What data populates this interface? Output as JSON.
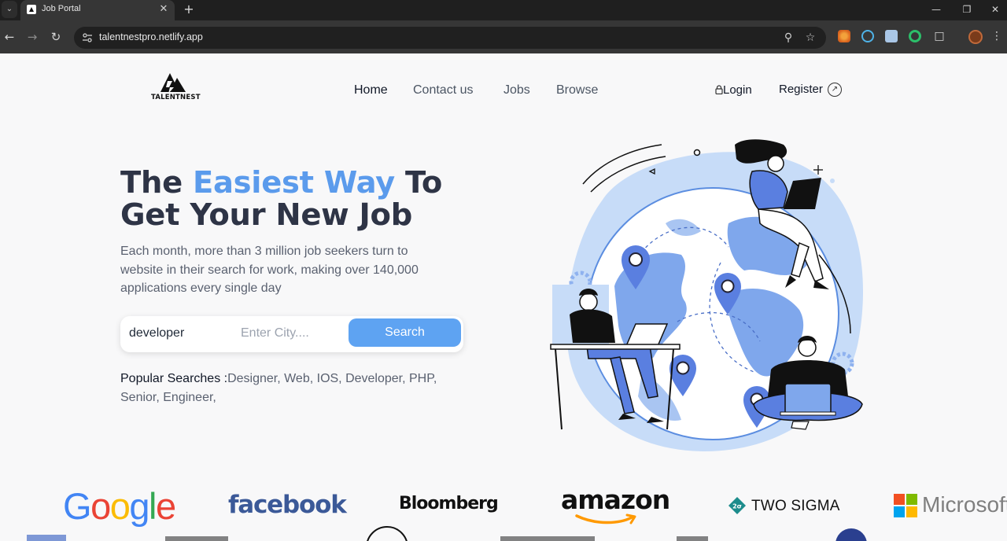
{
  "browser": {
    "tab_title": "Job Portal",
    "url": "talentnestpro.netlify.app"
  },
  "header": {
    "logo_text": "TALENTNEST",
    "nav": [
      {
        "label": "Home",
        "active": true
      },
      {
        "label": "Contact us",
        "active": false
      },
      {
        "label": "Jobs",
        "active": false
      },
      {
        "label": "Browse",
        "active": false
      }
    ],
    "login_label": "Login",
    "register_label": "Register"
  },
  "hero": {
    "title_part1": "The ",
    "title_highlight": "Easiest Way",
    "title_part2": " To",
    "title_line2": "Get Your New Job",
    "description": "Each month, more than 3 million job seekers turn to website in their search for work, making over 140,000 applications every single day"
  },
  "search": {
    "keyword_value": "developer",
    "city_placeholder": "Enter City....",
    "button_label": "Search"
  },
  "popular": {
    "label": "Popular Searches :",
    "terms": "Designer, Web, IOS, Developer, PHP, Senior, Engineer,"
  },
  "companies": [
    {
      "name": "Google"
    },
    {
      "name": "facebook"
    },
    {
      "name": "Bloomberg"
    },
    {
      "name": "amazon"
    },
    {
      "name": "TWO SIGMA"
    },
    {
      "name": "Microsoft"
    }
  ],
  "colors": {
    "accent": "#5b9bec",
    "button": "#5ea3f2",
    "heading": "#2e3446"
  }
}
